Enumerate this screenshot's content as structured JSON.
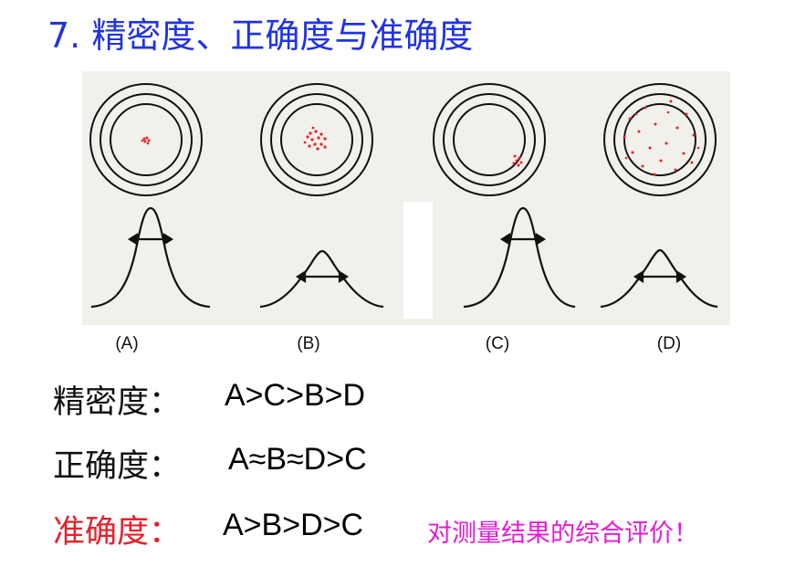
{
  "title": "7. 精密度、正确度与准确度",
  "panels": [
    {
      "label": "(A)"
    },
    {
      "label": "(B)"
    },
    {
      "label": "(C)"
    },
    {
      "label": "(D)"
    }
  ],
  "rows": [
    {
      "label": "精密度：",
      "value": "A>C>B>D"
    },
    {
      "label": "正确度：",
      "value": "A≈B≈D>C"
    },
    {
      "label": "准确度：",
      "value": "A>B>D>C",
      "note": "对测量结果的综合评价！"
    }
  ],
  "colors": {
    "title": "#1f33e6",
    "accuracy_label": "#e8202a",
    "note": "#e61ad6",
    "hit_marks": "#e8202a",
    "figure_background": "#f1f0ea"
  }
}
